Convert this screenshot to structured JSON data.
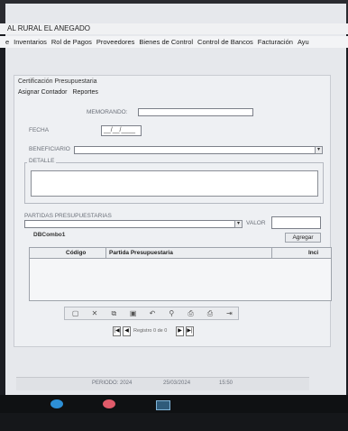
{
  "app": {
    "window_title": "AL RURAL EL ANEGADO",
    "menu": [
      "e",
      "Inventarios",
      "Rol de Pagos",
      "Proveedores",
      "Bienes de Control",
      "Control de Bancos",
      "Facturación",
      "Ayu"
    ]
  },
  "form": {
    "title": "Certificación Presupuestaria",
    "menu": [
      "Asignar Contador",
      "Reportes"
    ],
    "labels": {
      "memorandum": "MEMORANDO:",
      "fecha": "FECHA",
      "beneficiario": "BENEFICIARIO",
      "detalle": "DETALLE",
      "partidas": "PARTIDAS PRESUPUESTARIAS",
      "valor": "VALOR",
      "combo": "DBCombo1"
    },
    "fecha_value": "__/__/____",
    "agregar_label": "Agregar",
    "grid": {
      "headers": [
        "Código",
        "Partida Presupuestaria",
        "Inci"
      ]
    },
    "toolbar_icons": [
      "new-icon",
      "delete-icon",
      "copy-icon",
      "save-icon",
      "undo-icon",
      "find-icon",
      "print-icon",
      "print-preview-icon",
      "print-setup-icon",
      "exit-icon"
    ],
    "navigator": {
      "first": "|◀",
      "prev": "◀",
      "text": "Registro 0 de 0",
      "next": "▶",
      "last": "▶|"
    }
  },
  "status": {
    "periodo": "PERIODO: 2024",
    "fecha": "25/03/2024",
    "hora": "15:50"
  },
  "colors": {
    "screen_bg": "#e6e8ec",
    "form_bg": "#eef0f3",
    "taskbar": "#0f1113"
  }
}
